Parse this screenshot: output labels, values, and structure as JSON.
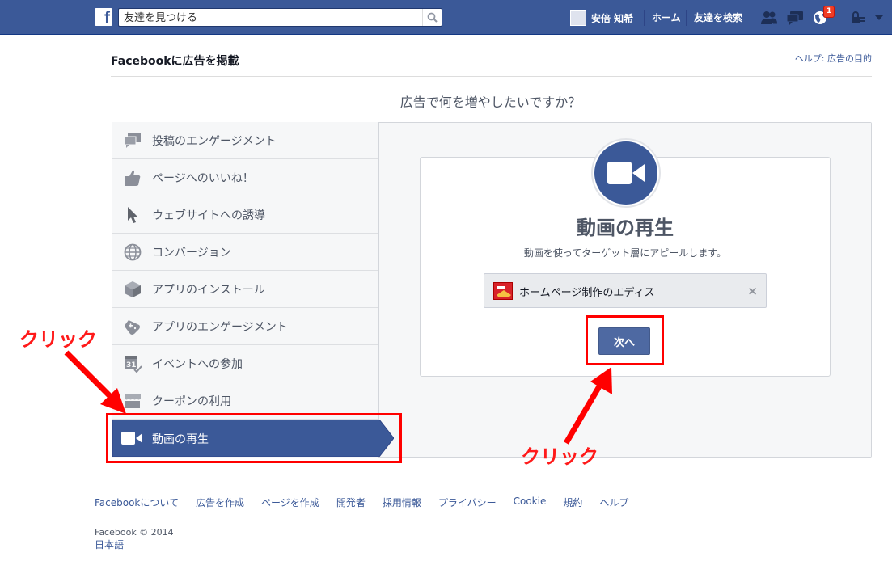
{
  "topbar": {
    "logo_letter": "f",
    "search_placeholder": "友達を見つける",
    "user_name": "安倍 知希",
    "home_label": "ホーム",
    "find_friends_label": "友達を検索",
    "notification_count": "1"
  },
  "header": {
    "title": "Facebookに広告を掲載",
    "help_link": "ヘルプ: 広告の目的"
  },
  "question": "広告で何を増やしたいですか？",
  "menu": {
    "items": [
      {
        "label": "投稿のエンゲージメント",
        "icon": "comments-icon"
      },
      {
        "label": "ページへのいいね！",
        "icon": "thumbs-up-icon"
      },
      {
        "label": "ウェブサイトへの誘導",
        "icon": "cursor-icon"
      },
      {
        "label": "コンバージョン",
        "icon": "globe-icon"
      },
      {
        "label": "アプリのインストール",
        "icon": "box-icon"
      },
      {
        "label": "アプリのエンゲージメント",
        "icon": "gamepad-icon"
      },
      {
        "label": "イベントへの参加",
        "icon": "calendar-icon"
      },
      {
        "label": "クーポンの利用",
        "icon": "store-icon"
      }
    ],
    "active": {
      "label": "動画の再生",
      "icon": "video-camera-icon"
    }
  },
  "card": {
    "title": "動画の再生",
    "description": "動画を使ってターゲット層にアピールします。",
    "page_name": "ホームページ制作のエディス",
    "close_symbol": "×",
    "next_label": "次へ"
  },
  "annotations": {
    "click_left": "クリック",
    "click_right": "クリック",
    "color": "#ff0000"
  },
  "footer": {
    "links": [
      "Facebookについて",
      "広告を作成",
      "ページを作成",
      "開発者",
      "採用情報",
      "プライバシー",
      "Cookie",
      "規約",
      "ヘルプ"
    ],
    "copyright": "Facebook © 2014",
    "language": "日本語"
  },
  "colors": {
    "brand": "#3b5998",
    "button": "#4e69a2",
    "text_gray": "#4e5665"
  }
}
